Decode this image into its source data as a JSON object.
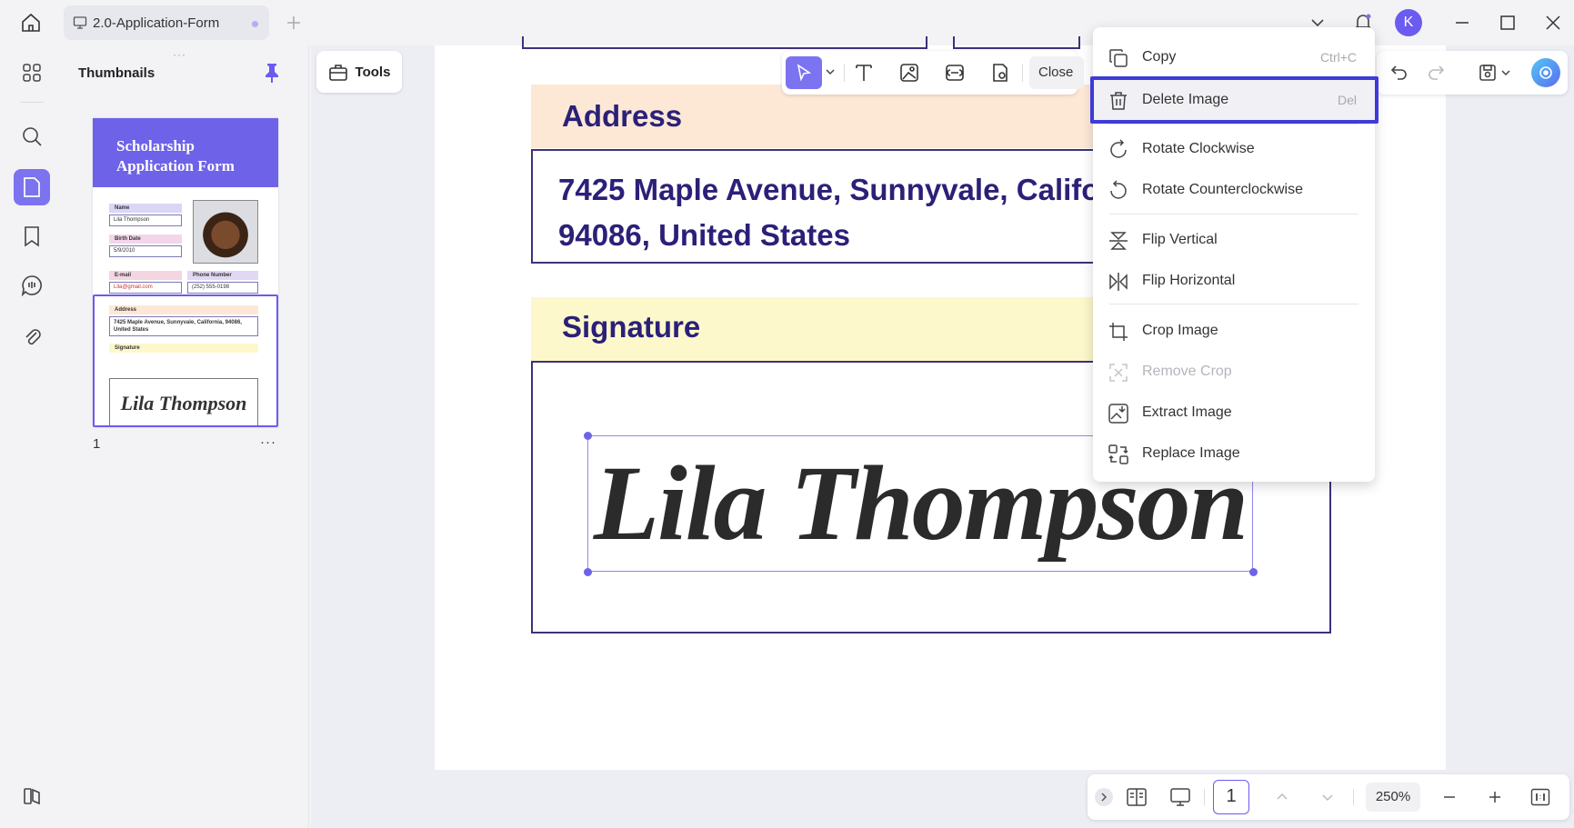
{
  "titlebar": {
    "tab_title": "2.0-Application-Form",
    "avatar_initial": "K"
  },
  "thumbnails": {
    "title": "Thumbnails",
    "page_label": "1",
    "more": "···",
    "grip": "···",
    "preview": {
      "header_title": "Scholarship Application Form",
      "name_label": "Name",
      "name_value": "Lila Thompson",
      "birth_label": "Birth Date",
      "birth_value": "5/9/2010",
      "email_label": "E-mail",
      "email_value": "Lila@gmail.com",
      "phone_label": "Phone Number",
      "phone_value": "(252) 555-0198",
      "address_label": "Address",
      "address_value": "7425 Maple Avenue, Sunnyvale, California, 94086, United States",
      "signature_label": "Signature",
      "signature_value": "Lila Thompson"
    }
  },
  "main": {
    "tools_label": "Tools",
    "edit_toolbar": {
      "close_label": "Close"
    },
    "document": {
      "address_heading": "Address",
      "address_line1": "7425 Maple Avenue, Sunnyvale, California,",
      "address_line2": "94086, United States",
      "signature_heading": "Signature",
      "signature_text": "Lila Thompson"
    },
    "bottom_bar": {
      "page_number": "1",
      "zoom": "250%"
    }
  },
  "context_menu": {
    "items": [
      {
        "label": "Copy",
        "shortcut": "Ctrl+C",
        "icon": "copy-icon"
      },
      {
        "label": "Delete Image",
        "shortcut": "Del",
        "icon": "trash-icon"
      },
      {
        "label": "Rotate Clockwise",
        "shortcut": "",
        "icon": "rotate-clockwise-icon"
      },
      {
        "label": "Rotate Counterclockwise",
        "shortcut": "",
        "icon": "rotate-counterclockwise-icon"
      },
      {
        "label": "Flip Vertical",
        "shortcut": "",
        "icon": "flip-vertical-icon"
      },
      {
        "label": "Flip Horizontal",
        "shortcut": "",
        "icon": "flip-horizontal-icon"
      },
      {
        "label": "Crop Image",
        "shortcut": "",
        "icon": "crop-icon"
      },
      {
        "label": "Remove Crop",
        "shortcut": "",
        "icon": "remove-crop-icon",
        "disabled": true
      },
      {
        "label": "Extract Image",
        "shortcut": "",
        "icon": "extract-image-icon"
      },
      {
        "label": "Replace Image",
        "shortcut": "",
        "icon": "replace-image-icon"
      }
    ]
  },
  "colors": {
    "accent": "#6b5bf0",
    "highlight_frame": "#3e3bd9",
    "heading_text": "#2b2078",
    "address_band": "#fde8d6",
    "signature_band": "#fdf8cc"
  }
}
